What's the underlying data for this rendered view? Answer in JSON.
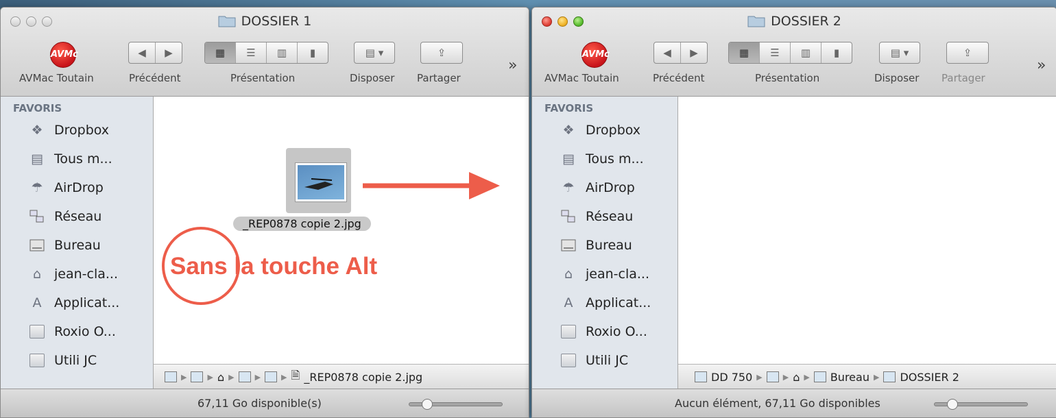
{
  "windows": [
    {
      "title": "DOSSIER 1",
      "toolbar": {
        "avmac_label": "AVMac Toutain",
        "logo_text": "AVMc",
        "prev_label": "Précédent",
        "view_label": "Présentation",
        "arrange_label": "Disposer",
        "share_label": "Partager"
      },
      "sidebar": {
        "heading": "FAVORIS",
        "items": [
          {
            "label": "Dropbox",
            "icon": "dropbox-icon",
            "glyph": "❖"
          },
          {
            "label": "Tous m...",
            "icon": "all-files-icon",
            "glyph": "▤"
          },
          {
            "label": "AirDrop",
            "icon": "airdrop-icon",
            "glyph": "☂"
          },
          {
            "label": "Réseau",
            "icon": "network-icon",
            "glyph": "🖧"
          },
          {
            "label": "Bureau",
            "icon": "desktop-icon",
            "glyph": "▭"
          },
          {
            "label": "jean-cla...",
            "icon": "home-icon",
            "glyph": "⌂"
          },
          {
            "label": "Applicat...",
            "icon": "applications-icon",
            "glyph": "A"
          },
          {
            "label": "Roxio O...",
            "icon": "folder-icon",
            "glyph": ""
          },
          {
            "label": "Utili JC",
            "icon": "folder-icon",
            "glyph": ""
          }
        ]
      },
      "file": {
        "name": "_REP0878 copie 2.jpg"
      },
      "annotation": {
        "text_circled": "Sans",
        "text_rest": " la touche Alt"
      },
      "path": [
        "_REP0878 copie 2.jpg"
      ],
      "status": "67,11 Go disponible(s)"
    },
    {
      "title": "DOSSIER 2",
      "toolbar": {
        "avmac_label": "AVMac Toutain",
        "logo_text": "AVMc",
        "prev_label": "Précédent",
        "view_label": "Présentation",
        "arrange_label": "Disposer",
        "share_label": "Partager"
      },
      "sidebar": {
        "heading": "FAVORIS",
        "items": [
          {
            "label": "Dropbox",
            "icon": "dropbox-icon",
            "glyph": "❖"
          },
          {
            "label": "Tous m...",
            "icon": "all-files-icon",
            "glyph": "▤"
          },
          {
            "label": "AirDrop",
            "icon": "airdrop-icon",
            "glyph": "☂"
          },
          {
            "label": "Réseau",
            "icon": "network-icon",
            "glyph": "🖧"
          },
          {
            "label": "Bureau",
            "icon": "desktop-icon",
            "glyph": "▭"
          },
          {
            "label": "jean-cla...",
            "icon": "home-icon",
            "glyph": "⌂"
          },
          {
            "label": "Applicat...",
            "icon": "applications-icon",
            "glyph": "A"
          },
          {
            "label": "Roxio O...",
            "icon": "folder-icon",
            "glyph": ""
          },
          {
            "label": "Utili JC",
            "icon": "folder-icon",
            "glyph": ""
          }
        ]
      },
      "path": [
        "DD 750",
        "Bureau",
        "DOSSIER 2"
      ],
      "status": "Aucun élément, 67,11 Go disponibles"
    }
  ],
  "colors": {
    "annotation": "#ed5d4a",
    "sidebar_bg": "#e1e6ec"
  }
}
